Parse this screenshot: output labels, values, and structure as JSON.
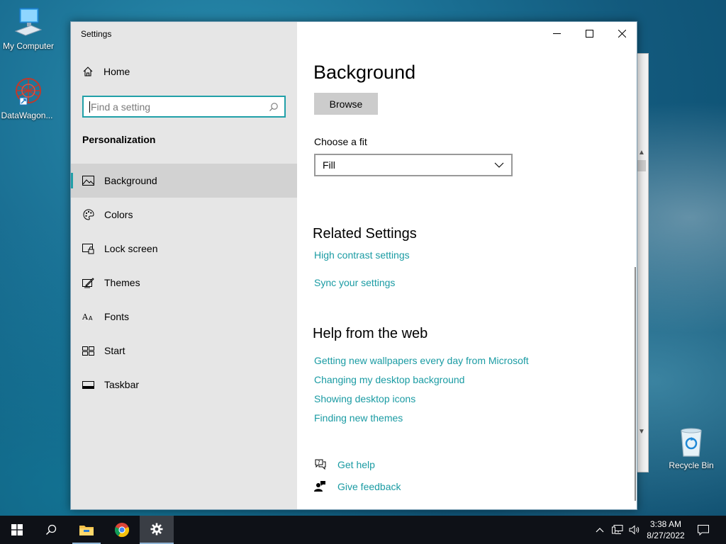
{
  "desktop": {
    "icons": [
      {
        "label": "My Computer",
        "icon": "computer-icon"
      },
      {
        "label": "DataWagon...",
        "icon": "datawagon-icon"
      },
      {
        "label": "Recycle Bin",
        "icon": "recycle-bin-icon"
      }
    ]
  },
  "settings_window": {
    "title": "Settings",
    "sidebar": {
      "home_label": "Home",
      "search_placeholder": "Find a setting",
      "section_heading": "Personalization",
      "items": [
        {
          "label": "Background",
          "icon": "picture-icon",
          "active": true
        },
        {
          "label": "Colors",
          "icon": "palette-icon",
          "active": false
        },
        {
          "label": "Lock screen",
          "icon": "lock-screen-icon",
          "active": false
        },
        {
          "label": "Themes",
          "icon": "themes-icon",
          "active": false
        },
        {
          "label": "Fonts",
          "icon": "fonts-icon",
          "active": false
        },
        {
          "label": "Start",
          "icon": "start-icon",
          "active": false
        },
        {
          "label": "Taskbar",
          "icon": "taskbar-icon",
          "active": false
        }
      ]
    },
    "content": {
      "page_title": "Background",
      "browse_label": "Browse",
      "fit_label": "Choose a fit",
      "fit_value": "Fill",
      "related_heading": "Related Settings",
      "related_links": [
        "High contrast settings",
        "Sync your settings"
      ],
      "help_heading": "Help from the web",
      "help_links": [
        "Getting new wallpapers every day from Microsoft",
        "Changing my desktop background",
        "Showing desktop icons",
        "Finding new themes"
      ],
      "get_help_label": "Get help",
      "give_feedback_label": "Give feedback"
    }
  },
  "taskbar": {
    "time": "3:38 AM",
    "date": "8/27/2022"
  },
  "colors": {
    "accent": "#1a9ba3",
    "taskbar": "#0e1117"
  }
}
